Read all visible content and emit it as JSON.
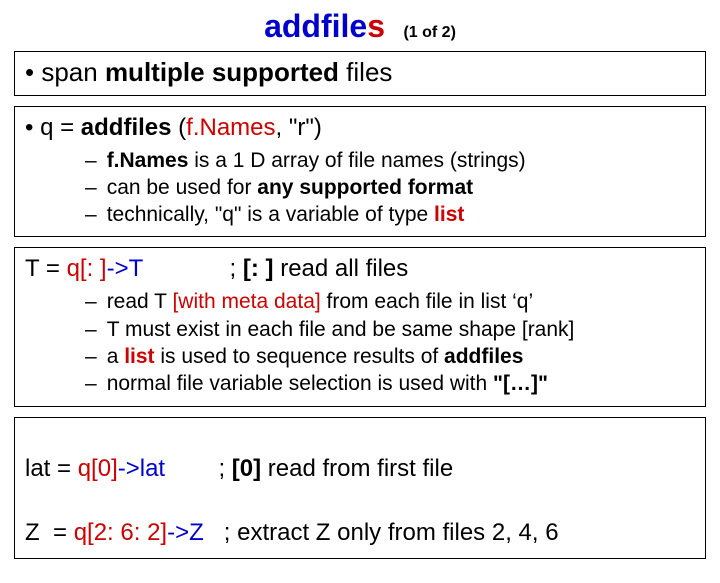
{
  "title": {
    "main": "addfile",
    "suffix": "s",
    "pager": "(1 of 2)"
  },
  "box1": {
    "line": {
      "pre": "• span  ",
      "bold": "multiple supported",
      "post": " files"
    }
  },
  "box2": {
    "line": {
      "pre": "• q  = ",
      "fn": "addfiles",
      "paren_open": " (",
      "arg": "f.Names",
      "rest": ", \"r\")"
    },
    "sub": [
      {
        "p1": "",
        "b1": "f.Names",
        "p2": " is a 1 D array of file names (strings)",
        "b2": "",
        "p3": ""
      },
      {
        "p1": "can be used for ",
        "b1": "any supported format",
        "p2": "",
        "b2": "",
        "p3": ""
      },
      {
        "p1": "technically, \"q\" is a variable of type ",
        "b1": "",
        "p2": "",
        "b2": "list",
        "p3": ""
      }
    ]
  },
  "box3": {
    "line": {
      "t1": "T = ",
      "q": "q[: ]",
      "arrow": "->T",
      "space": "             ",
      "semi": "; ",
      "b": "[: ]",
      "rest": " read all files"
    },
    "sub": [
      {
        "p1": "read T ",
        "r1": "[with meta data]",
        "p2": " from each file in list ‘q’"
      },
      {
        "p1": "T must exist in each file and be same shape [rank]",
        "r1": "",
        "p2": ""
      },
      {
        "p1": "a ",
        "r1": "list",
        "p2": " is used to sequence results of ",
        "b1": "addfiles"
      },
      {
        "p1": "normal file variable selection is used with ",
        "r1": "",
        "p2": "",
        "q1": "\"[…]\""
      }
    ]
  },
  "box4": {
    "l1": {
      "a": "lat = ",
      "q": "q[0]",
      "arr": "->lat",
      "sp": "        ",
      "semi": "; ",
      "b": "[0]",
      "rest": " read from first file"
    },
    "l2": {
      "a": "Z  = ",
      "q": "q[2: 6: 2]",
      "arr": "->Z",
      "sp": "   ",
      "semi": "; extract Z only from files 2, 4, 6"
    }
  }
}
